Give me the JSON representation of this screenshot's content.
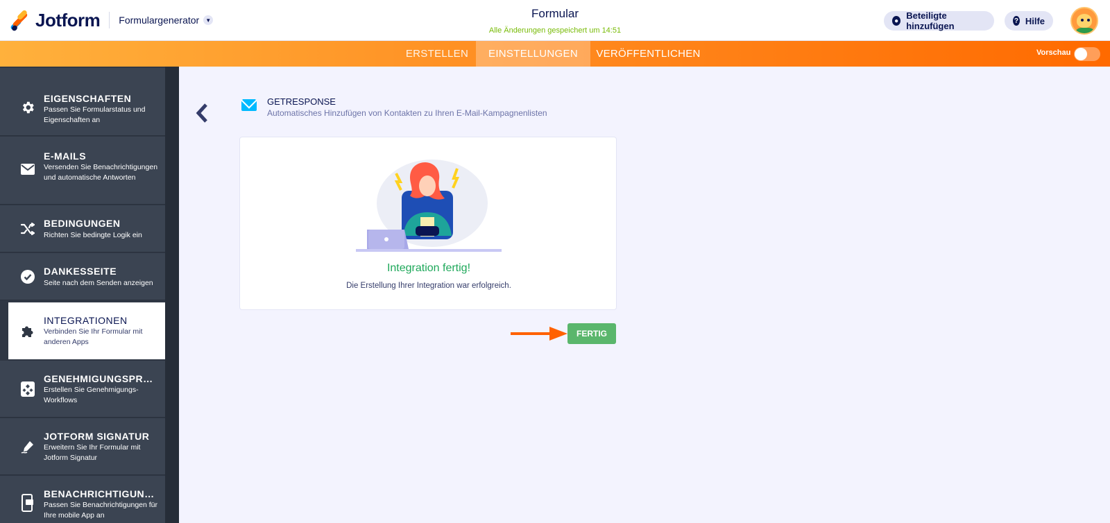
{
  "header": {
    "logo_text": "Jotform",
    "builder_label": "Formulargenerator",
    "form_title": "Formular",
    "saved_status": "Alle Änderungen gespeichert um 14:51",
    "invite_label": "Beteiligte hinzufügen",
    "help_label": "Hilfe"
  },
  "nav": {
    "tabs": [
      {
        "label": "ERSTELLEN"
      },
      {
        "label": "EINSTELLUNGEN",
        "active": true
      },
      {
        "label": "VERÖFFENTLICHEN"
      }
    ],
    "preview_label": "Vorschau",
    "preview_on": false
  },
  "sidebar": {
    "items": [
      {
        "title": "EIGENSCHAFTEN",
        "desc": "Passen Sie Formularstatus und Eigenschaften an",
        "icon": "gear-icon"
      },
      {
        "title": "E-MAILS",
        "desc": "Versenden Sie Benachrichtigungen und automatische Antworten",
        "icon": "envelope-icon"
      },
      {
        "title": "BEDINGUNGEN",
        "desc": "Richten Sie bedingte Logik ein",
        "icon": "shuffle-icon"
      },
      {
        "title": "DANKESSEITE",
        "desc": "Seite nach dem Senden anzeigen",
        "icon": "check-circle-icon"
      },
      {
        "title": "INTEGRATIONEN",
        "desc": "Verbinden Sie Ihr Formular mit anderen Apps",
        "icon": "puzzle-icon",
        "active": true
      },
      {
        "title": "GENEHMIGUNGSPRO...",
        "desc": "Erstellen Sie Genehmigungs-Workflows",
        "icon": "workflow-icon"
      },
      {
        "title": "JOTFORM SIGNATUR",
        "desc": "Erweitern Sie Ihr Formular mit Jotform Signatur",
        "icon": "pen-icon"
      },
      {
        "title": "BENACHRICHTIGUNG...",
        "desc": "Passen Sie Benachrichtigungen für Ihre mobile App an",
        "icon": "mobile-icon"
      }
    ]
  },
  "integration": {
    "name": "GETRESPONSE",
    "description": "Automatisches Hinzufügen von Kontakten zu Ihren E-Mail-Kampagnenlisten",
    "success_title": "Integration fertig!",
    "success_text": "Die Erstellung Ihrer Integration war erfolgreich.",
    "done_label": "FERTIG"
  },
  "colors": {
    "accent_orange": "#ff6100",
    "success_green": "#5ab66c",
    "sidebar_bg": "#2f3744",
    "getresponse_blue": "#00baff"
  }
}
